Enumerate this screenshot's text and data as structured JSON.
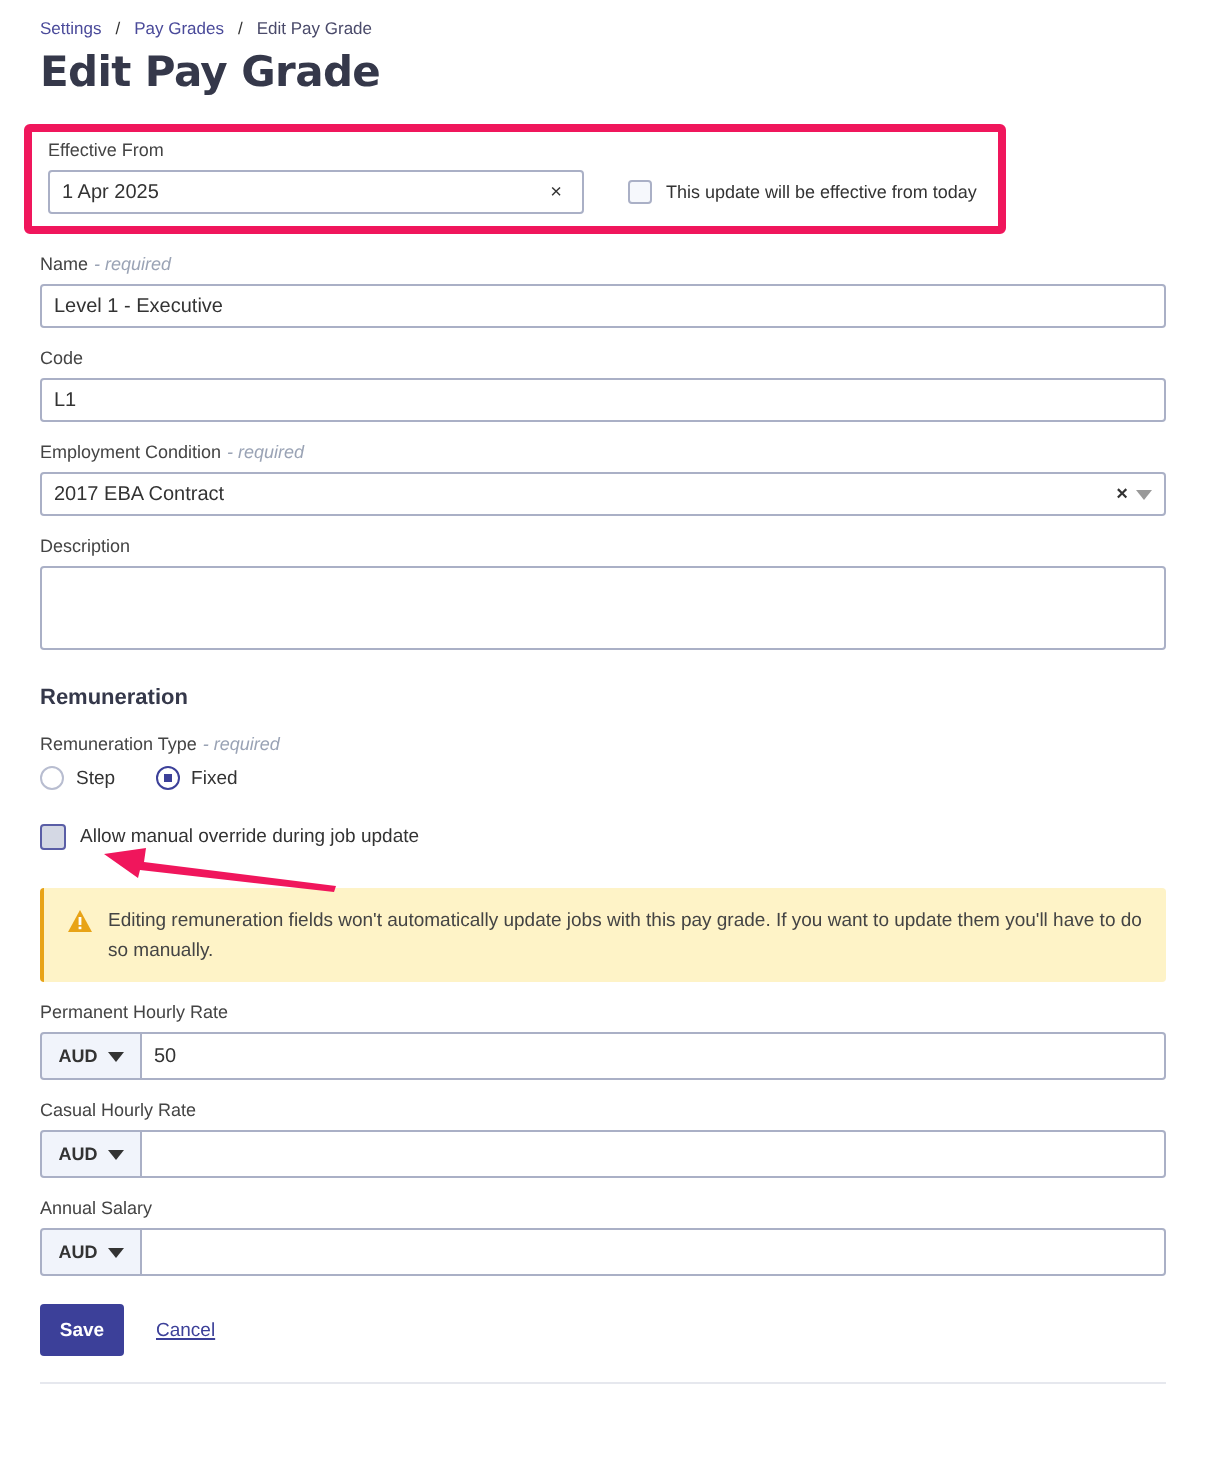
{
  "breadcrumbs": [
    {
      "label": "Settings"
    },
    {
      "label": "Pay Grades"
    },
    {
      "label": "Edit Pay Grade"
    }
  ],
  "breadcrumb_separator": "/",
  "title": "Edit Pay Grade",
  "effective": {
    "label": "Effective From",
    "value": "1 Apr 2025",
    "clear": "×",
    "checkbox": {
      "label": "This update will be effective from today",
      "checked": false
    }
  },
  "fields": [
    {
      "kind": "text",
      "label": "Name",
      "note": "- required",
      "value": "Level 1 - Executive"
    },
    {
      "kind": "text",
      "label": "Code",
      "value": "L1"
    },
    {
      "kind": "select",
      "label": "Employment Condition",
      "note": "- required",
      "value": "2017 EBA Contract",
      "clear": "×"
    },
    {
      "kind": "textarea",
      "label": "Description"
    }
  ],
  "remuneration": {
    "heading": "Remuneration",
    "type_label": "Remuneration Type",
    "type_note": "- required",
    "options": [
      {
        "label": "Step",
        "selected": false
      },
      {
        "label": "Fixed",
        "selected": true
      }
    ],
    "override": {
      "label": "Allow manual override during job update",
      "checked": false
    },
    "warning": "Editing remuneration fields won't automatically update jobs with this pay grade. If you want to update them you'll have to do so manually.",
    "rates": [
      {
        "label": "Permanent Hourly Rate",
        "currency": "AUD",
        "value": "50"
      },
      {
        "label": "Casual Hourly Rate",
        "currency": "AUD"
      },
      {
        "label": "Annual Salary",
        "currency": "AUD"
      }
    ]
  },
  "buttons": {
    "save": "Save",
    "cancel": "Cancel"
  }
}
